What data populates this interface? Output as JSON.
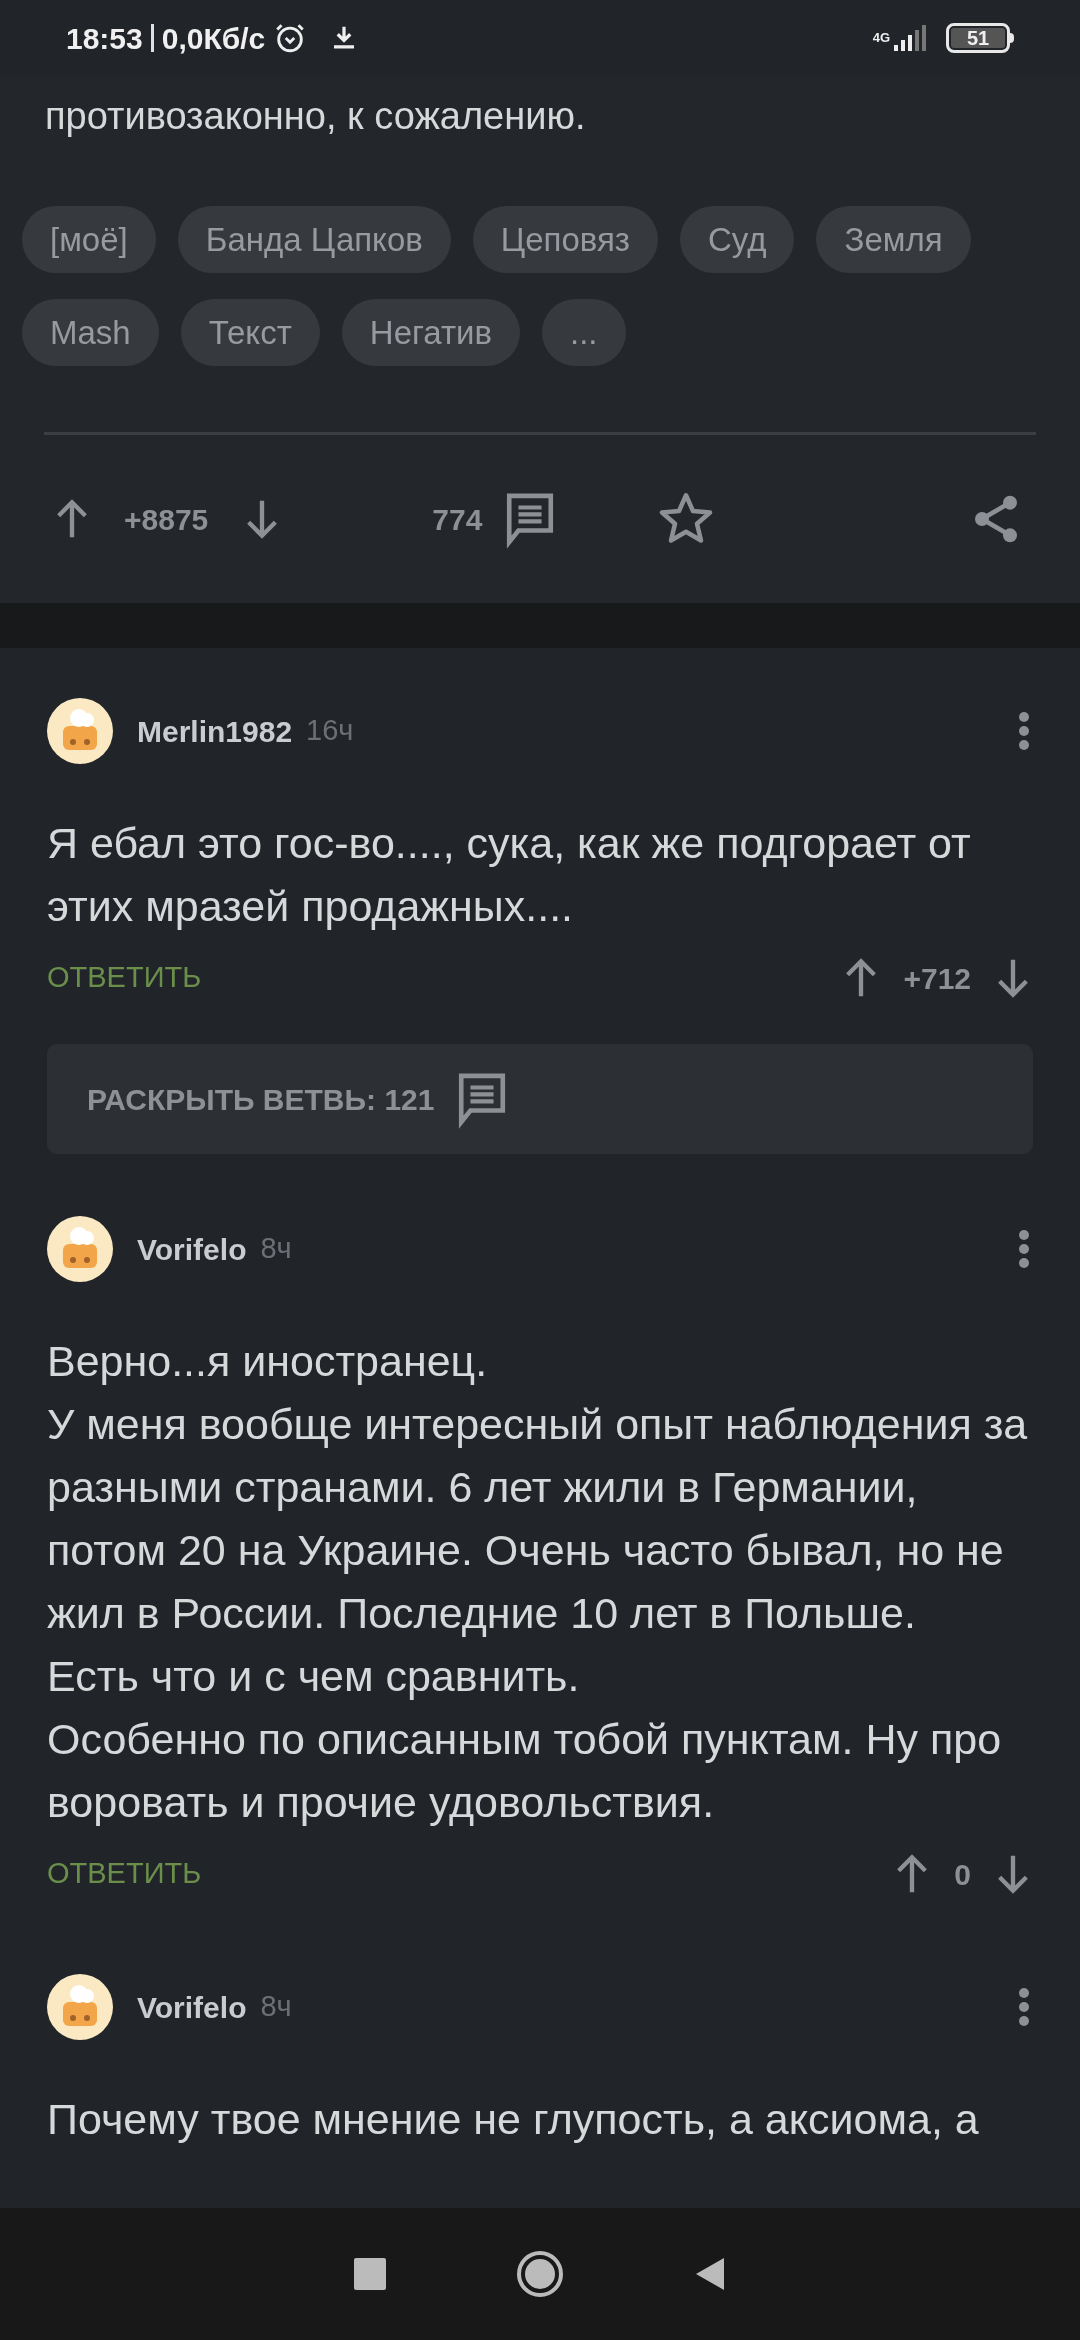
{
  "status_bar": {
    "time": "18:53",
    "speed": "0,0Кб/с",
    "network": "4G",
    "battery": "51"
  },
  "post": {
    "text_tail": "противозаконно, к сожалению.",
    "tags": [
      "[моё]",
      "Банда Цапков",
      "Цеповяз",
      "Суд",
      "Земля",
      "Mash",
      "Текст",
      "Негатив",
      "..."
    ],
    "rating": "+8875",
    "comments": "774"
  },
  "comments": [
    {
      "author": "Merlin1982",
      "time": "16ч",
      "lines": [
        "Я ебал это гос-во...., сука, как же подгорает от этих мразей продажных...."
      ],
      "reply": "ОТВЕТИТЬ",
      "rating": "+712",
      "expand": "РАСКРЫТЬ ВЕТВЬ: 121"
    },
    {
      "author": "Vorifelo",
      "time": "8ч",
      "lines": [
        "Верно...я иностранец.",
        "У меня вообще интересный опыт наблюдения за разными странами. 6 лет жили в Германии, потом 20 на Украине. Очень часто бывал, но не жил в России. Последние 10 лет в Польше.",
        "Есть что и с чем сравнить.",
        "Особенно по описанным тобой пунктам. Ну про воровать и прочие удовольствия."
      ],
      "reply": "ОТВЕТИТЬ",
      "rating": "0"
    },
    {
      "author": "Vorifelo",
      "time": "8ч",
      "lines": [
        "Почему твое мнение не глупость, а аксиома, а"
      ]
    }
  ]
}
